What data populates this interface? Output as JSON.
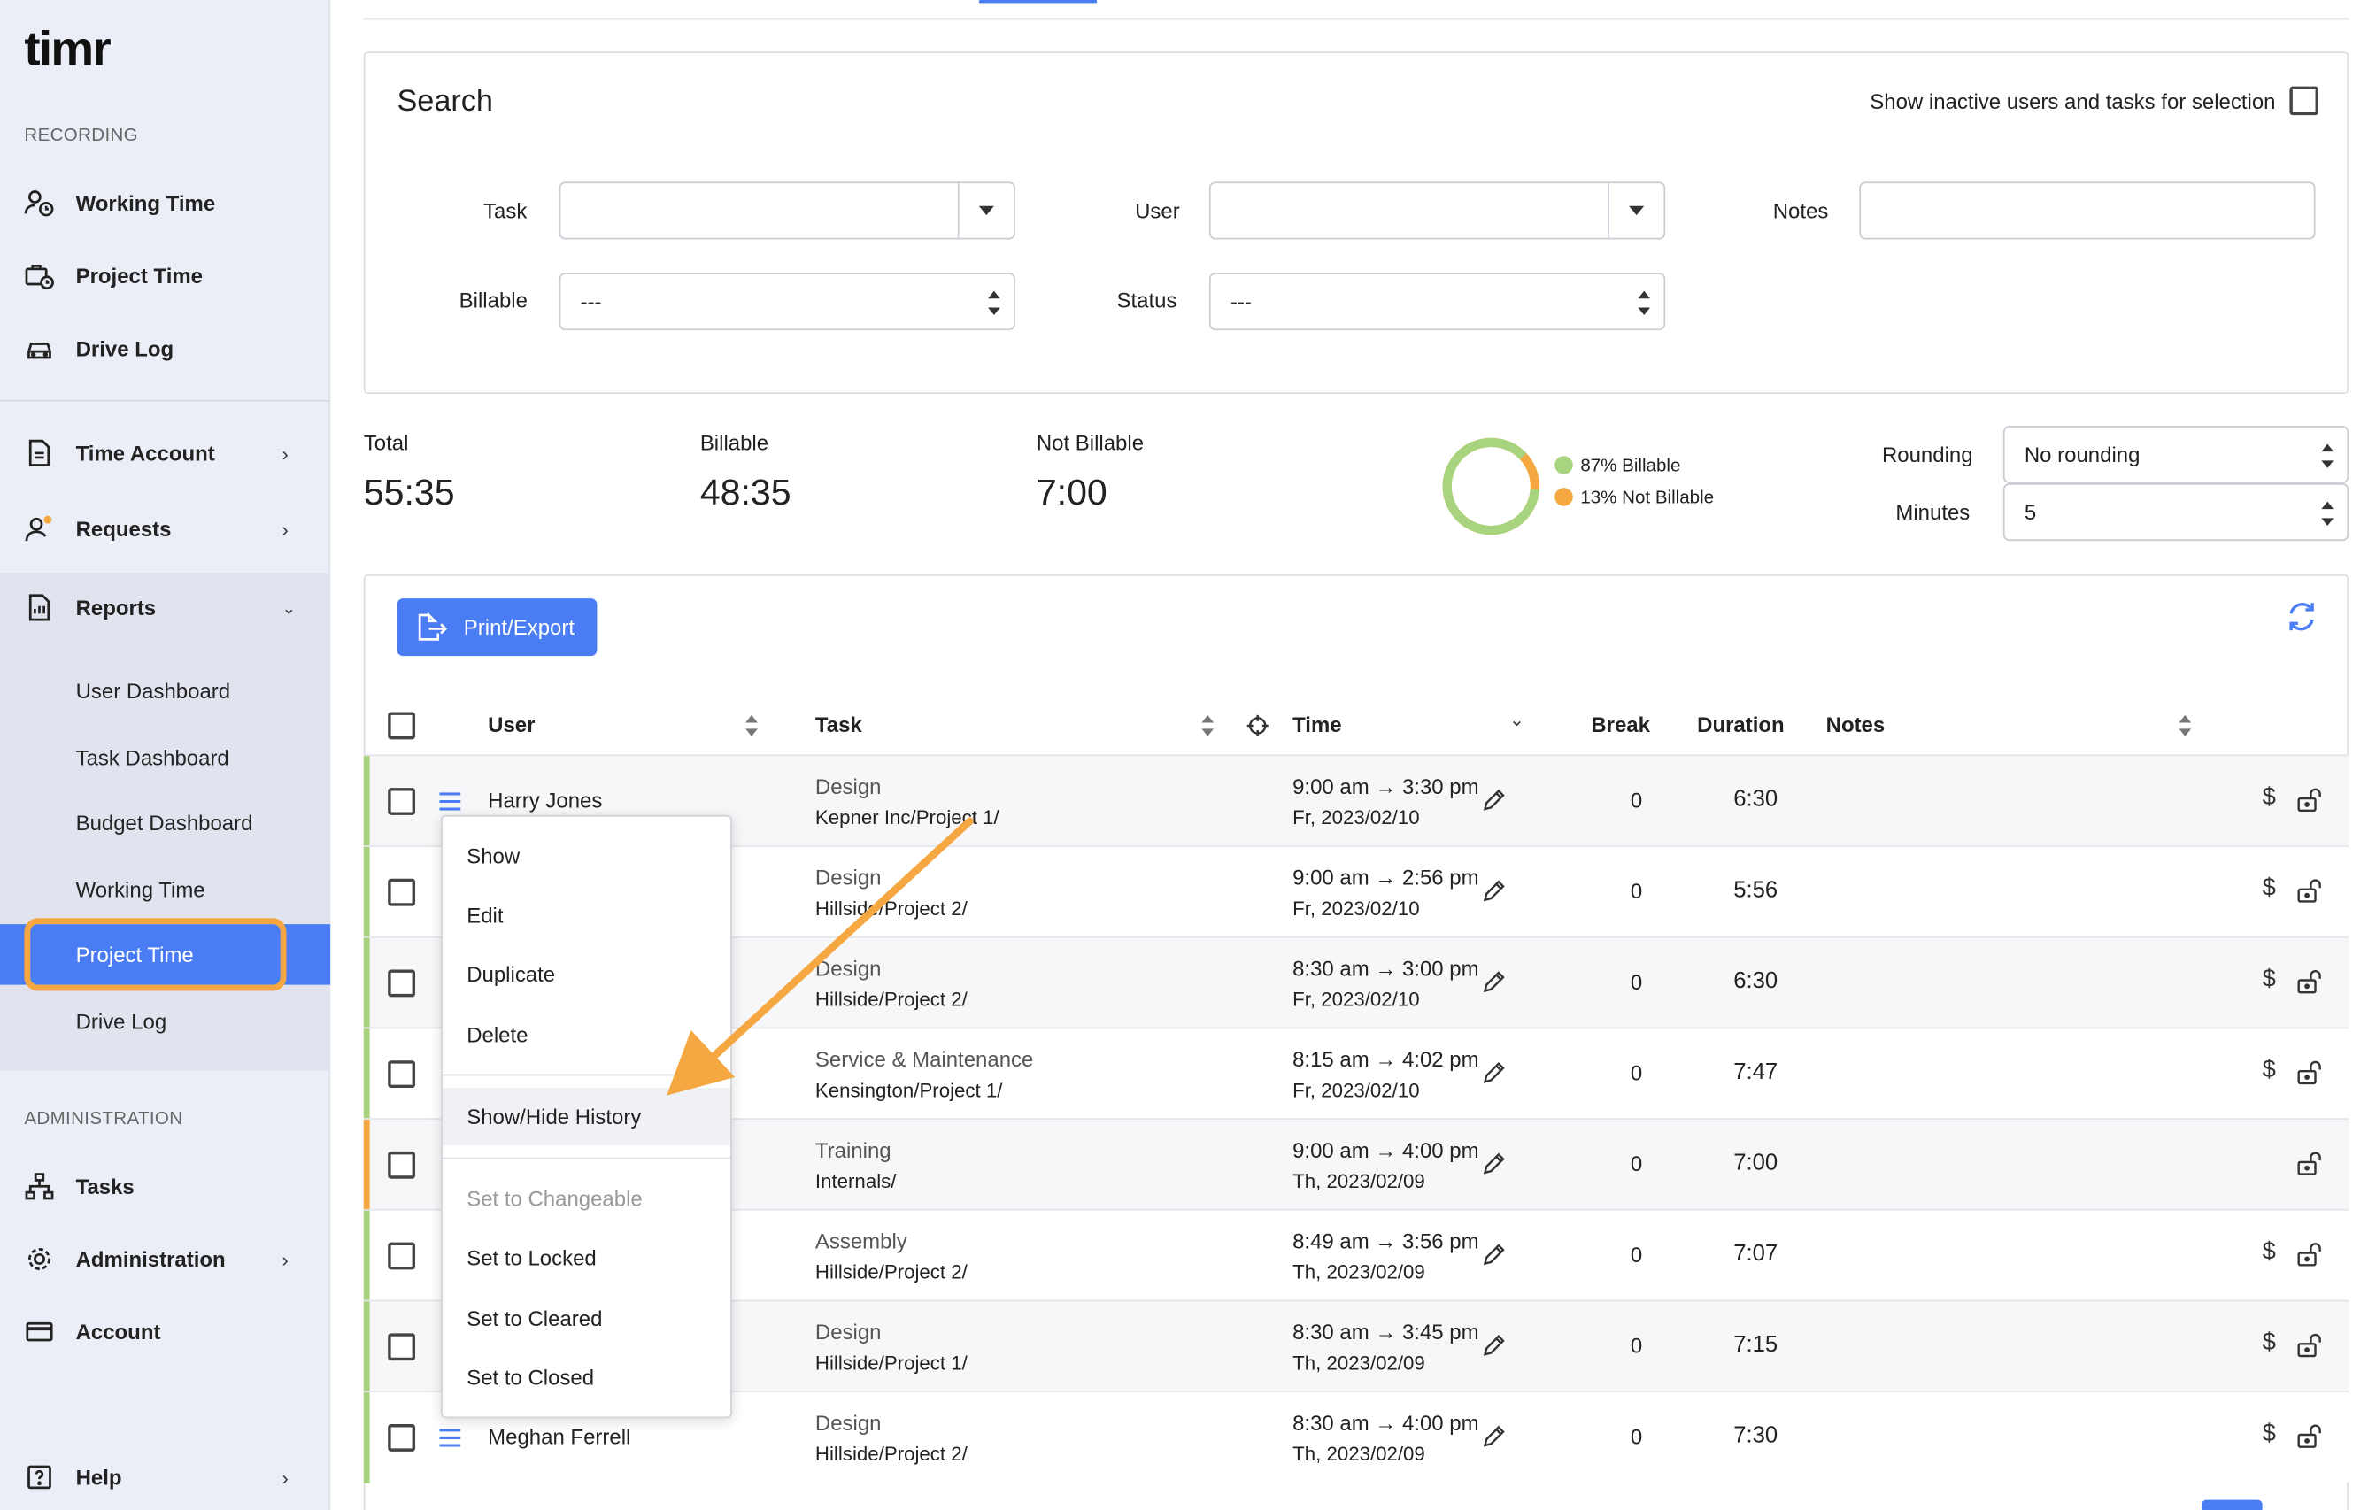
{
  "app": {
    "logo": "timr"
  },
  "sidebar": {
    "sections": {
      "recording": "RECORDING",
      "administration": "ADMINISTRATION"
    },
    "recording_items": [
      {
        "label": "Working Time",
        "icon": "user-clock-icon"
      },
      {
        "label": "Project Time",
        "icon": "briefcase-clock-icon"
      },
      {
        "label": "Drive Log",
        "icon": "car-icon"
      }
    ],
    "middle_items": [
      {
        "label": "Time Account",
        "icon": "document-icon"
      },
      {
        "label": "Requests",
        "icon": "user-badge-icon"
      },
      {
        "label": "Reports",
        "icon": "report-icon"
      }
    ],
    "report_subitems": [
      "User Dashboard",
      "Task Dashboard",
      "Budget Dashboard",
      "Working Time",
      "Project Time",
      "Drive Log"
    ],
    "active_subitem": "Project Time",
    "admin_items": [
      {
        "label": "Tasks",
        "icon": "hierarchy-icon"
      },
      {
        "label": "Administration",
        "icon": "gear-icon"
      },
      {
        "label": "Account",
        "icon": "credit-card-icon"
      }
    ],
    "help": {
      "label": "Help",
      "icon": "help-icon"
    }
  },
  "search": {
    "title": "Search",
    "show_inactive_label": "Show inactive users and tasks for selection",
    "task_label": "Task",
    "user_label": "User",
    "notes_label": "Notes",
    "billable_label": "Billable",
    "billable_value": "---",
    "status_label": "Status",
    "status_value": "---"
  },
  "summary": {
    "total_label": "Total",
    "total_value": "55:35",
    "billable_label": "Billable",
    "billable_value": "48:35",
    "not_billable_label": "Not Billable",
    "not_billable_value": "7:00",
    "legend_billable": "87% Billable",
    "legend_not_billable": "13% Not Billable",
    "billable_fraction": 0.87,
    "colors": {
      "billable": "#a9d47f",
      "not_billable": "#f5a742"
    },
    "rounding_label": "Rounding",
    "rounding_value": "No rounding",
    "minutes_label": "Minutes",
    "minutes_value": "5"
  },
  "toolbar": {
    "print_export": "Print/Export"
  },
  "table": {
    "headers": {
      "user": "User",
      "task": "Task",
      "time": "Time",
      "break": "Break",
      "duration": "Duration",
      "notes": "Notes"
    },
    "rows": [
      {
        "user": "Harry Jones",
        "task": "Design",
        "project": "Kepner Inc/Project 1/",
        "time": "9:00 am → 3:30 pm",
        "date": "Fr, 2023/02/10",
        "break": "0",
        "duration": "6:30",
        "billable": true,
        "status_color": "#a9d47f"
      },
      {
        "user": "",
        "task": "Design",
        "project": "Hillside/Project 2/",
        "time": "9:00 am → 2:56 pm",
        "date": "Fr, 2023/02/10",
        "break": "0",
        "duration": "5:56",
        "billable": true,
        "status_color": "#a9d47f"
      },
      {
        "user": "",
        "task": "Design",
        "project": "Hillside/Project 2/",
        "time": "8:30 am → 3:00 pm",
        "date": "Fr, 2023/02/10",
        "break": "0",
        "duration": "6:30",
        "billable": true,
        "status_color": "#a9d47f"
      },
      {
        "user": "",
        "task": "Service & Maintenance",
        "project": "Kensington/Project 1/",
        "time": "8:15 am → 4:02 pm",
        "date": "Fr, 2023/02/10",
        "break": "0",
        "duration": "7:47",
        "billable": true,
        "status_color": "#a9d47f"
      },
      {
        "user": "",
        "task": "Training",
        "project": "Internals/",
        "time": "9:00 am → 4:00 pm",
        "date": "Th, 2023/02/09",
        "break": "0",
        "duration": "7:00",
        "billable": false,
        "status_color": "#f5a742"
      },
      {
        "user": "",
        "task": "Assembly",
        "project": "Hillside/Project 2/",
        "time": "8:49 am → 3:56 pm",
        "date": "Th, 2023/02/09",
        "break": "0",
        "duration": "7:07",
        "billable": true,
        "status_color": "#a9d47f"
      },
      {
        "user": "",
        "task": "Design",
        "project": "Hillside/Project 1/",
        "time": "8:30 am → 3:45 pm",
        "date": "Th, 2023/02/09",
        "break": "0",
        "duration": "7:15",
        "billable": true,
        "status_color": "#a9d47f"
      },
      {
        "user": "Meghan Ferrell",
        "task": "Design",
        "project": "Hillside/Project 2/",
        "time": "8:30 am → 4:00 pm",
        "date": "Th, 2023/02/09",
        "break": "0",
        "duration": "7:30",
        "billable": true,
        "status_color": "#a9d47f"
      }
    ]
  },
  "context_menu": {
    "items": [
      "Show",
      "Edit",
      "Duplicate",
      "Delete"
    ],
    "history": "Show/Hide History",
    "status_items": [
      "Set to Changeable",
      "Set to Locked",
      "Set to Cleared",
      "Set to Closed"
    ],
    "disabled_item": "Set to Changeable"
  },
  "colors": {
    "accent": "#4a7df3",
    "highlight": "#f5a742",
    "sidebar_bg": "#eceef7"
  }
}
